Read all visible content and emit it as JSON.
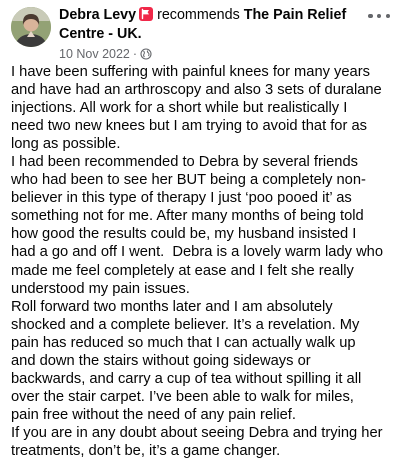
{
  "post": {
    "author": "Debra Levy",
    "verb": "recommends",
    "page_name": "The Pain Relief Centre - UK",
    "page_suffix": ".",
    "date": "10 Nov 2022",
    "separator": "·",
    "privacy_icon": "globe-icon",
    "recommend_icon": "flag-icon",
    "more_icon": "more-options-icon",
    "brand_color": "#f02849",
    "text": "I have been suffering with painful knees for many years\nand have had an arthroscopy and also 3 sets of duralane\ninjections. All work for a short while but realistically I\nneed two new knees but I am trying to avoid that for as\nlong as possible.\nI had been recommended to Debra by several friends\nwho had been to see her BUT being a completely non-\nbeliever in this type of therapy I just ‘poo pooed it’ as\nsomething not for me. After many months of being told\nhow good the results could be, my husband insisted I\nhad a go and off I went.  Debra is a lovely warm lady who\nmade me feel completely at ease and I felt she really\nunderstood my pain issues.\nRoll forward two months later and I am absolutely\nshocked and a complete believer. It’s a revelation. My\npain has reduced so much that I can actually walk up\nand down the stairs without going sideways or\nbackwards, and carry a cup of tea without spilling it all\nover the stair carpet. I’ve been able to walk for miles,\npain free without the need of any pain relief.\nIf you are in any doubt about seeing Debra and trying her\ntreatments, don’t be, it’s a game changer."
  }
}
